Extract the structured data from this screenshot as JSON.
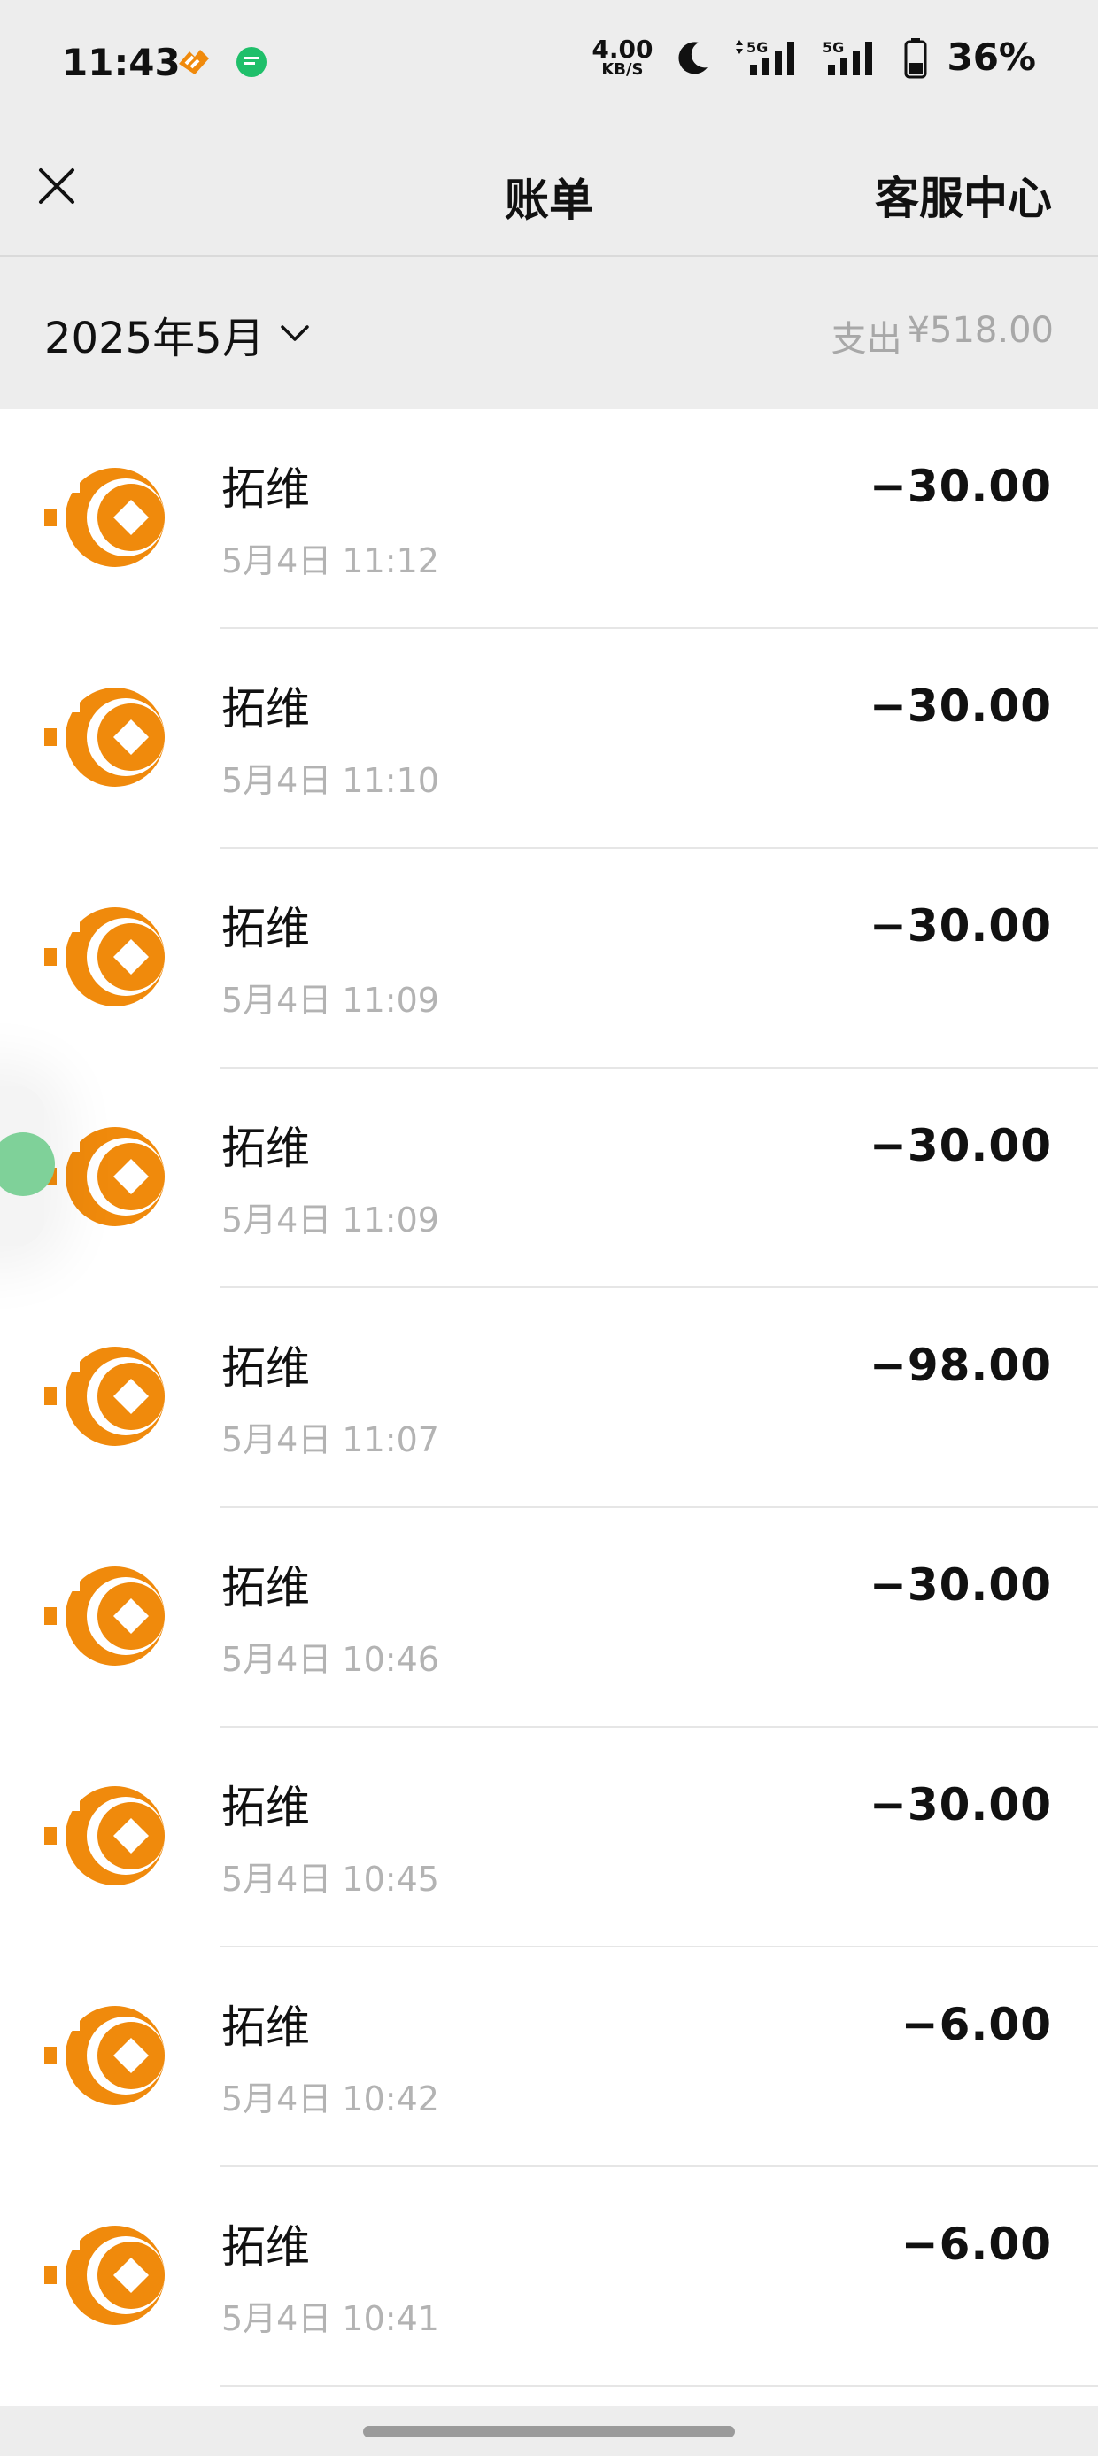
{
  "status_bar": {
    "time": "11:43",
    "net_speed_value": "4.00",
    "net_speed_unit": "KB/S",
    "sim1": "5G",
    "sim2": "5G",
    "battery_percent": "36%"
  },
  "header": {
    "close_icon": "close-icon",
    "title": "账单",
    "service_label": "客服中心"
  },
  "month_bar": {
    "month_label": "2025年5月",
    "total_label": "支出",
    "total_amount": "¥518.00"
  },
  "colors": {
    "accent_orange": "#f08a0c",
    "background": "#ededed"
  },
  "bills": [
    {
      "name": "拓维",
      "time": "5月4日 11:12",
      "amount": "−30.00"
    },
    {
      "name": "拓维",
      "time": "5月4日 11:10",
      "amount": "−30.00"
    },
    {
      "name": "拓维",
      "time": "5月4日 11:09",
      "amount": "−30.00"
    },
    {
      "name": "拓维",
      "time": "5月4日 11:09",
      "amount": "−30.00"
    },
    {
      "name": "拓维",
      "time": "5月4日 11:07",
      "amount": "−98.00"
    },
    {
      "name": "拓维",
      "time": "5月4日 10:46",
      "amount": "−30.00"
    },
    {
      "name": "拓维",
      "time": "5月4日 10:45",
      "amount": "−30.00"
    },
    {
      "name": "拓维",
      "time": "5月4日 10:42",
      "amount": "−6.00"
    },
    {
      "name": "拓维",
      "time": "5月4日 10:41",
      "amount": "−6.00"
    }
  ]
}
